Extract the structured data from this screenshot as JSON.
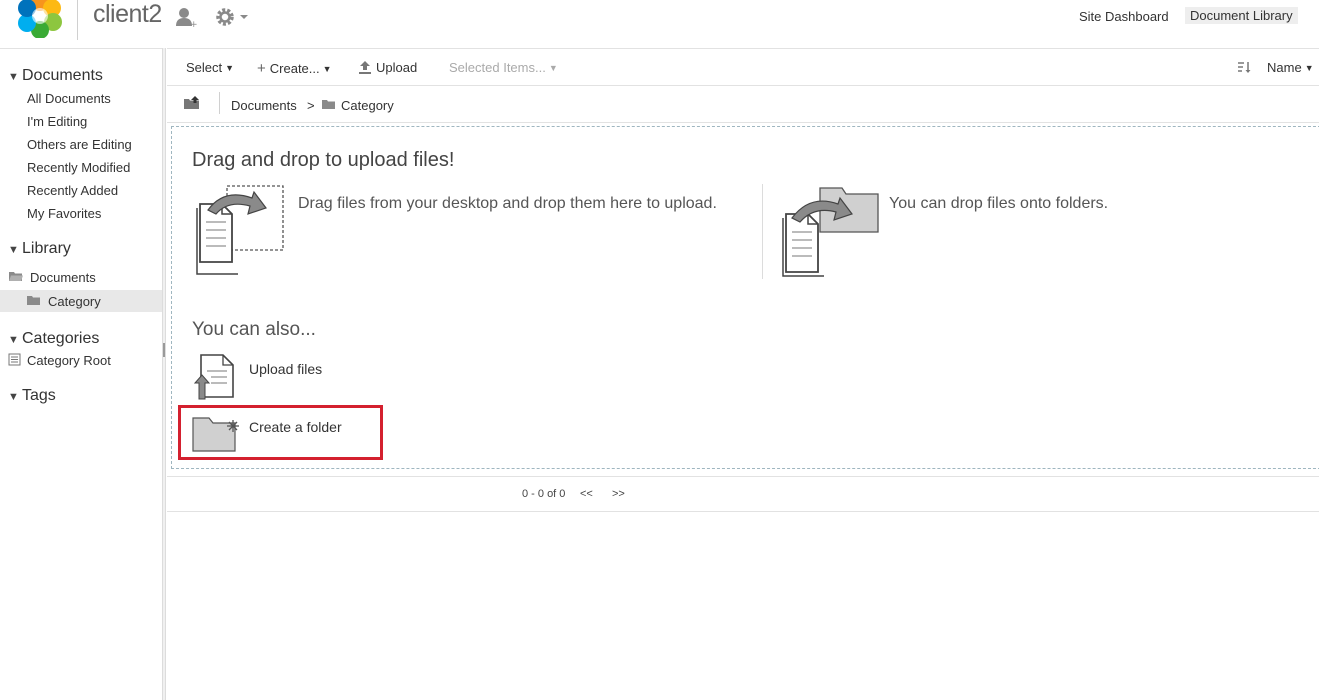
{
  "header": {
    "site_name": "client2",
    "nav": {
      "site_dashboard": "Site Dashboard",
      "document_library": "Document Library"
    }
  },
  "sidebar": {
    "documents_heading": "Documents",
    "document_filters": [
      "All Documents",
      "I'm Editing",
      "Others are Editing",
      "Recently Modified",
      "Recently Added",
      "My Favorites"
    ],
    "library_heading": "Library",
    "library_tree": [
      "Documents",
      "Category"
    ],
    "categories_heading": "Categories",
    "category_root": "Category Root",
    "tags_heading": "Tags"
  },
  "toolbar": {
    "select": "Select",
    "create": "Create...",
    "upload": "Upload",
    "selected_items": "Selected Items...",
    "sort_field": "Name"
  },
  "breadcrumb": {
    "root": "Documents",
    "separator": ">",
    "current": "Category"
  },
  "dropzone": {
    "title": "Drag and drop to upload files!",
    "desktop_hint": "Drag files from your desktop and drop them here to upload.",
    "folder_hint": "You can drop files onto folders.",
    "also_title": "You can also...",
    "upload_files": "Upload files",
    "create_folder": "Create a folder"
  },
  "pager": {
    "range": "0 - 0 of 0",
    "prev": "<<",
    "next": ">>"
  },
  "colors": {
    "highlight": "#d4202f",
    "selected_row": "#e8e8e8"
  }
}
